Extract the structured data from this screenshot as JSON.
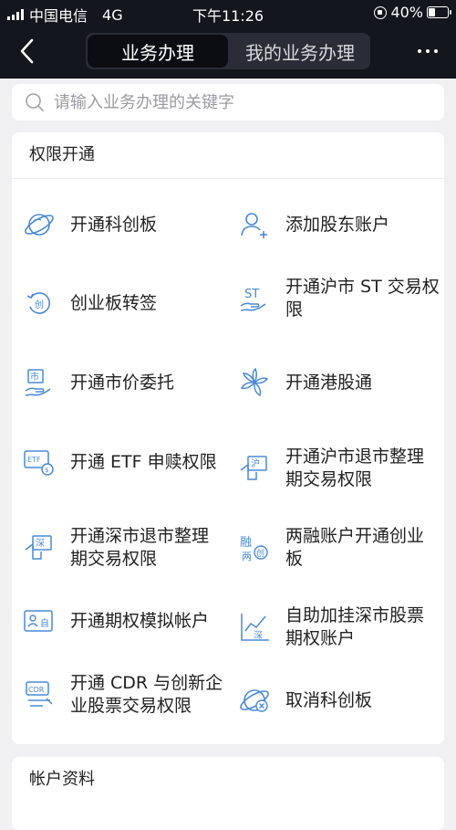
{
  "status": {
    "carrier": "中国电信",
    "network": "4G",
    "time": "下午11:26",
    "battery": "40%",
    "battery_level": 0.4
  },
  "nav": {
    "tabs": [
      {
        "label": "业务办理",
        "active": true
      },
      {
        "label": "我的业务办理",
        "active": false
      }
    ],
    "back_icon": "chevron-left-icon",
    "more_icon": "more-dots-icon"
  },
  "search": {
    "placeholder": "请输入业务办理的关键字"
  },
  "sections": [
    {
      "title": "权限开通",
      "items": [
        {
          "label": "开通科创板",
          "icon": "planet-icon"
        },
        {
          "label": "添加股东账户",
          "icon": "add-user-icon"
        },
        {
          "label": "创业板转签",
          "icon": "renew-icon"
        },
        {
          "label": "开通沪市 ST 交易权限",
          "icon": "st-hand-icon"
        },
        {
          "label": "开通市价委托",
          "icon": "market-hand-icon"
        },
        {
          "label": "开通港股通",
          "icon": "bauhinia-icon"
        },
        {
          "label": "开通 ETF 申赎权限",
          "icon": "etf-card-icon"
        },
        {
          "label": "开通沪市退市整理期交易权限",
          "icon": "hu-board-icon"
        },
        {
          "label": "开通深市退市整理期交易权限",
          "icon": "shen-board-icon"
        },
        {
          "label": "两融账户开通创业板",
          "icon": "rong-chuang-icon"
        },
        {
          "label": "开通期权模拟帐户",
          "icon": "id-card-icon"
        },
        {
          "label": "自助加挂深市股票期权账户",
          "icon": "chart-shen-icon"
        },
        {
          "label": "开通 CDR 与创新企业股票交易权限",
          "icon": "cdr-icon"
        },
        {
          "label": "取消科创板",
          "icon": "planet-cancel-icon"
        }
      ]
    },
    {
      "title": "帐户资料",
      "items": []
    }
  ],
  "colors": {
    "topbar": "#14161e",
    "accent": "#4a8ad4",
    "background": "#f0f0f3"
  }
}
